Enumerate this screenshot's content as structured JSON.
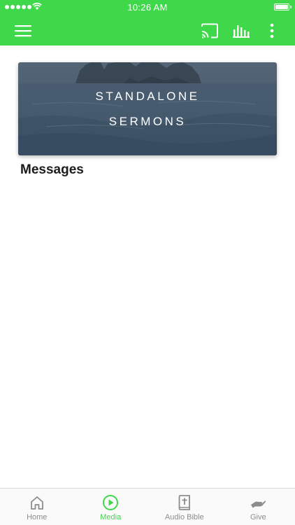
{
  "status_bar": {
    "time": "10:26 AM"
  },
  "toolbar": {
    "menu_icon": "hamburger-menu-icon",
    "cast_icon": "cast-icon",
    "bars_icon": "equalizer-bars-icon",
    "more_icon": "more-vertical-icon"
  },
  "featured": {
    "title_line1": "STANDALONE",
    "title_line2": "SERMONS"
  },
  "section": {
    "title": "Messages"
  },
  "bottom_nav": {
    "items": [
      {
        "label": "Home",
        "icon": "home-icon",
        "active": false
      },
      {
        "label": "Media",
        "icon": "play-circle-icon",
        "active": true
      },
      {
        "label": "Audio Bible",
        "icon": "bible-icon",
        "active": false
      },
      {
        "label": "Give",
        "icon": "give-hand-icon",
        "active": false
      }
    ]
  },
  "colors": {
    "brand_green": "#3fd84a",
    "inactive_gray": "#8c8c8c"
  }
}
